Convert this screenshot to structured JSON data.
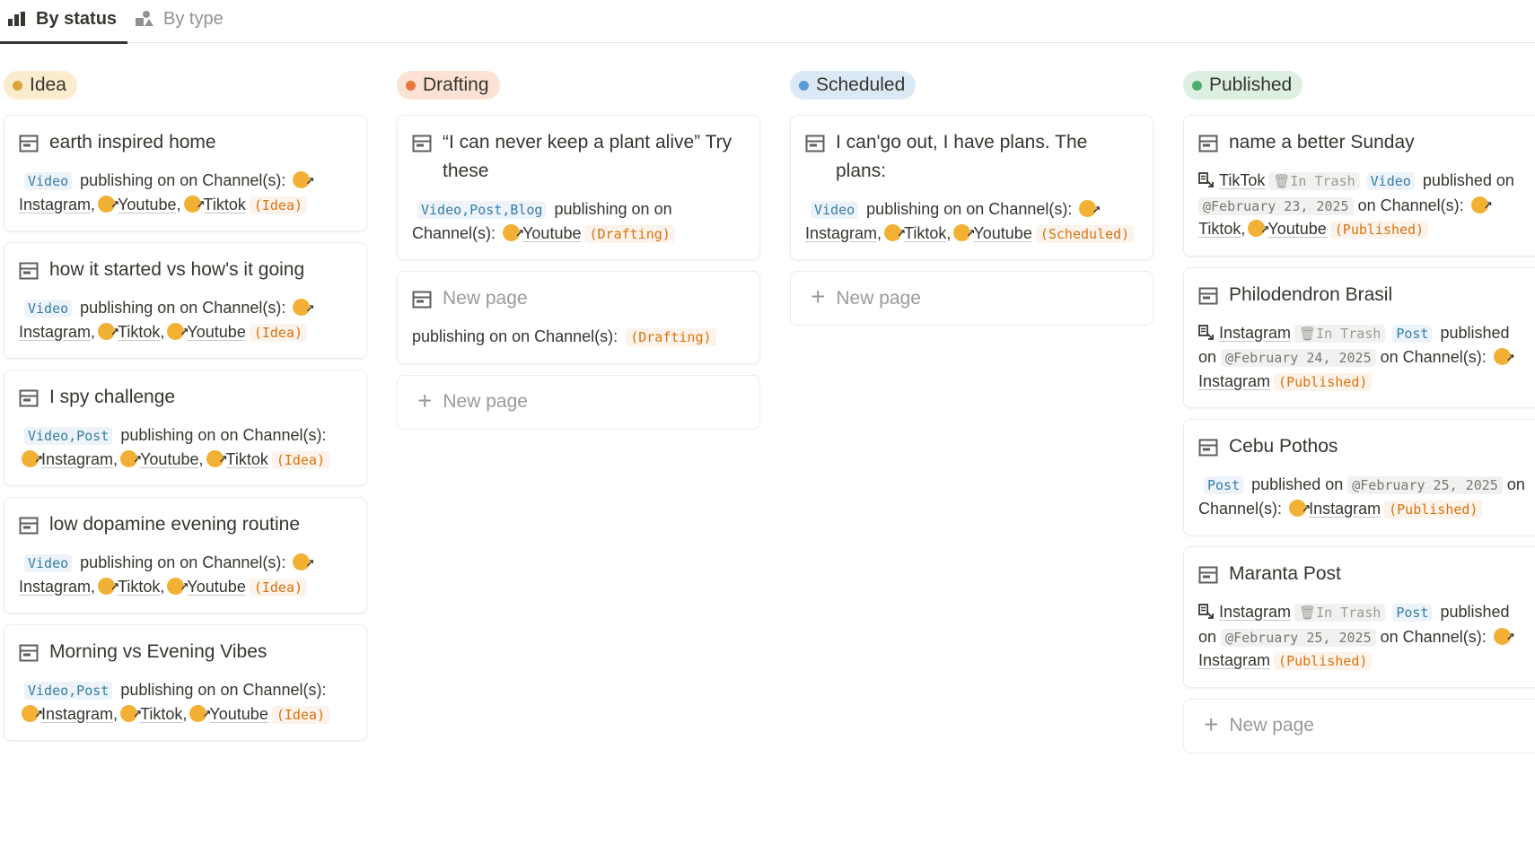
{
  "tabs": [
    {
      "label": "By status",
      "active": true
    },
    {
      "label": "By type",
      "active": false
    }
  ],
  "columns": [
    {
      "name": "Idea",
      "color": "#d9a53a",
      "bg": "#fbeccd",
      "cards": [
        {
          "title": "earth inspired home",
          "verb": "publishing on",
          "tags": [
            "Video"
          ],
          "channels": [
            "Instagram",
            "Youtube",
            "Tiktok"
          ],
          "status": "(Idea)"
        },
        {
          "title": "how it started vs how's it going",
          "verb": "publishing on",
          "tags": [
            "Video"
          ],
          "channels": [
            "Instagram",
            "Tiktok",
            "Youtube"
          ],
          "status": "(Idea)"
        },
        {
          "title": "I spy challenge",
          "verb": "publishing on",
          "tags": [
            "Video,Post"
          ],
          "channels": [
            "Instagram",
            "Youtube",
            "Tiktok"
          ],
          "status": "(Idea)"
        },
        {
          "title": "low dopamine evening routine",
          "verb": "publishing on",
          "tags": [
            "Video"
          ],
          "channels": [
            "Instagram",
            "Tiktok",
            "Youtube"
          ],
          "status": "(Idea)"
        },
        {
          "title": "Morning vs Evening Vibes",
          "verb": "publishing on",
          "tags": [
            "Video,Post"
          ],
          "channels": [
            "Instagram",
            "Tiktok",
            "Youtube"
          ],
          "status": "(Idea)"
        }
      ],
      "new_page": null
    },
    {
      "name": "Drafting",
      "color": "#e8763d",
      "bg": "#fbe2d4",
      "cards": [
        {
          "title": "“I can never keep a plant alive” Try these",
          "verb": "publishing on",
          "tags": [
            "Video,Post,Blog"
          ],
          "channels": [
            "Youtube"
          ],
          "status": "(Drafting)"
        },
        {
          "title": "New page",
          "placeholder": true,
          "verb": "publishing on",
          "tags": [],
          "channels": [],
          "status": "(Drafting)"
        }
      ],
      "new_page": "New page"
    },
    {
      "name": "Scheduled",
      "color": "#5b9bd5",
      "bg": "#dbe9f6",
      "cards": [
        {
          "title": "I can'go out, I have plans. The plans:",
          "verb": "publishing on",
          "tags": [
            "Video"
          ],
          "channels": [
            "Instagram",
            "Tiktok",
            "Youtube"
          ],
          "status": "(Scheduled)"
        }
      ],
      "new_page": "New page"
    },
    {
      "name": "Published",
      "color": "#4caf6a",
      "bg": "#dcefe1",
      "cards": [
        {
          "title": "name a better Sunday",
          "type": "TikTok",
          "trash": "In Trash",
          "verb": "published on",
          "tags": [
            "Video"
          ],
          "date": "@February 23, 2025",
          "channels": [
            "Tiktok",
            "Youtube"
          ],
          "status": "(Published)"
        },
        {
          "title": "Philodendron Brasil",
          "type": "Instagram",
          "trash": "In Trash",
          "verb": "published on",
          "tags": [
            "Post"
          ],
          "date": "@February 24, 2025",
          "channels": [
            "Instagram"
          ],
          "status": "(Published)"
        },
        {
          "title": "Cebu Pothos",
          "verb": "published on",
          "tags": [
            "Post"
          ],
          "date": "@February 25, 2025",
          "channels": [
            "Instagram"
          ],
          "status": "(Published)"
        },
        {
          "title": "Maranta Post",
          "type": "Instagram",
          "trash": "In Trash",
          "verb": "published on",
          "tags": [
            "Post"
          ],
          "date": "@February 25, 2025",
          "channels": [
            "Instagram"
          ],
          "status": "(Published)"
        }
      ],
      "new_page": "New page"
    }
  ],
  "labels": {
    "on": "on",
    "channels": "on Channel(s):",
    "channels_bare": "Channel(s):"
  },
  "icons": {
    "board_tab": "board-icon",
    "type_tab": "shapes-icon",
    "card": "page-icon",
    "channel": "channel-icon",
    "type": "type-icon",
    "trash": "trash-icon",
    "add": "plus-icon"
  }
}
